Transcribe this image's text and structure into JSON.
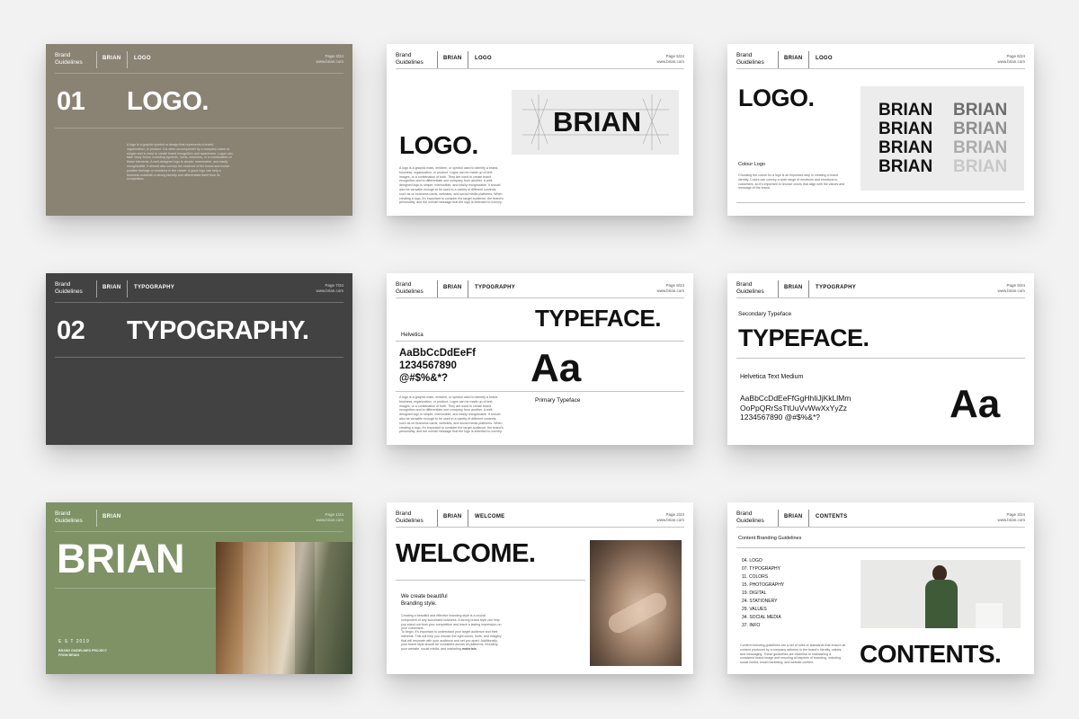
{
  "header": {
    "brand_line1": "Brand",
    "brand_line2": "Guidelines",
    "name": "BRIAN",
    "url": "www.brian.com"
  },
  "slides": [
    {
      "section": "LOGO",
      "page": "Page 3/24",
      "number": "01",
      "title": "LOGO.",
      "body": "A logo is a graphic symbol or design that represents a brand, organization, or product. It is often accompanied by a company name or slogan and is used to create brand recognition and awareness. Logos can take many forms, including symbols, icons, emblems, or a combination of these elements. A well-designed logo is simple, memorable, and easily recognizable. It should also convey the essence of the brand and evoke positive feelings or emotions in the viewer. A good logo can help a business establish a strong identity and differentiate itself from its competitors."
    },
    {
      "section": "LOGO",
      "page": "Page 5/24",
      "title": "LOGO.",
      "logo_text": "BRIAN",
      "body": "A logo is a graphic mark, emblem, or symbol used to identify a brand, business, organization, or product. Logos can be made up of text, images, or a combination of both. They are used to create brand recognition and to differentiate one company from another. A well-designed logo is simple, memorable, and easily recognizable. It should also be versatile enough to be used in a variety of different contexts, such as on business cards, websites, and social media platforms. When creating a logo, it's important to consider the target audience, the brand's personality, and the overall message that the logo is intended to convey."
    },
    {
      "section": "LOGO",
      "page": "Page 6/24",
      "title": "LOGO.",
      "subtitle": "Colour Logo",
      "logo_text": "BRIAN",
      "body": "Choosing the colors for a logo is an important step in creating a brand identity. Colors can convey a wide range of emotions and emotions to customers, so it's important to choose colors that align with the values and message of the brand."
    },
    {
      "section": "TYPOGRAPHY",
      "page": "Page 7/24",
      "number": "02",
      "title": "TYPOGRAPHY."
    },
    {
      "section": "TYPOGRAPHY",
      "page": "Page 8/24",
      "title": "TYPEFACE.",
      "font_name": "Helvetica",
      "glyph_line1": "AaBbCcDdEeFf",
      "glyph_line2": "1234567890",
      "glyph_line3": "@#$%&*?",
      "sample": "Aa",
      "caption": "Primary Typeface",
      "body": "A logo is a graphic mark, emblem, or symbol used to identify a brand, business, organization, or product. Logos can be made up of text, images, or a combination of both. They are used to create brand recognition and to differentiate one company from another. A well-designed logo is simple, memorable, and easily recognizable. It should also be versatile enough to be used in a variety of different contexts, such as on business cards, websites, and social media platforms. When creating a logo, it's important to consider the target audience, the brand's personality, and the overall message that the logo is intended to convey."
    },
    {
      "section": "TYPOGRAPHY",
      "page": "Page 9/24",
      "eyebrow": "Secondary Typeface",
      "title": "TYPEFACE.",
      "font_name": "Helvetica Text Medium",
      "glyph_line1": "AaBbCcDdEeFfGgHhIiJjKkLlMm",
      "glyph_line2": "OoPpQRrSsTtUuVvWwXxYyZz",
      "glyph_line3": "1234567890 @#$%&*?",
      "sample": "Aa"
    },
    {
      "page": "Page 1/24",
      "title": "BRIAN",
      "est": "E S T  2019",
      "project_line1": "BRAND GUIDELINES PROJECT",
      "project_line2": "FROM BRIAN"
    },
    {
      "section": "WELCOME",
      "page": "Page 2/24",
      "title": "WELCOME.",
      "tagline_line1": "We create beautiful",
      "tagline_line2": "Branding style.",
      "body1": "Creating a beautiful and effective branding style is a crucial component of any successful business. A strong brand style can help you stand out from your competition and leave a lasting impression on your customers.",
      "body2": "To begin, it's important to understand your target audience and their interests. This will help you choose the right colors, fonts, and imagery that will resonate with your audience and set you apart. Additionally, your brand style should be consistent across all platforms, including your website, social media, and marketing",
      "body2_end": "materials."
    },
    {
      "section": "CONTENTS",
      "page": "Page 3/24",
      "eyebrow": "Content Branding Guidelines",
      "title": "CONTENTS.",
      "items": [
        "04. LOGO",
        "07. TYPOGRAPHY",
        "11. COLORS",
        "15. PHOTOGRAPHY",
        "19. DIGITAL",
        "24. STATIONERY",
        "29. VALUES",
        "34. SOCIAL MEDIA",
        "37. INFO"
      ],
      "body": "Content branding guidelines are a set of rules or standards that ensure all content produced by a company adheres to the brand's identity, values, and messaging. These guidelines are essential to maintaining a consistent brand image and ensuring all aspects of branding, including social media, email marketing, and website content."
    }
  ],
  "colors": {
    "olive": "#8a8273",
    "charcoal": "#424242",
    "sage": "#7e9266"
  }
}
